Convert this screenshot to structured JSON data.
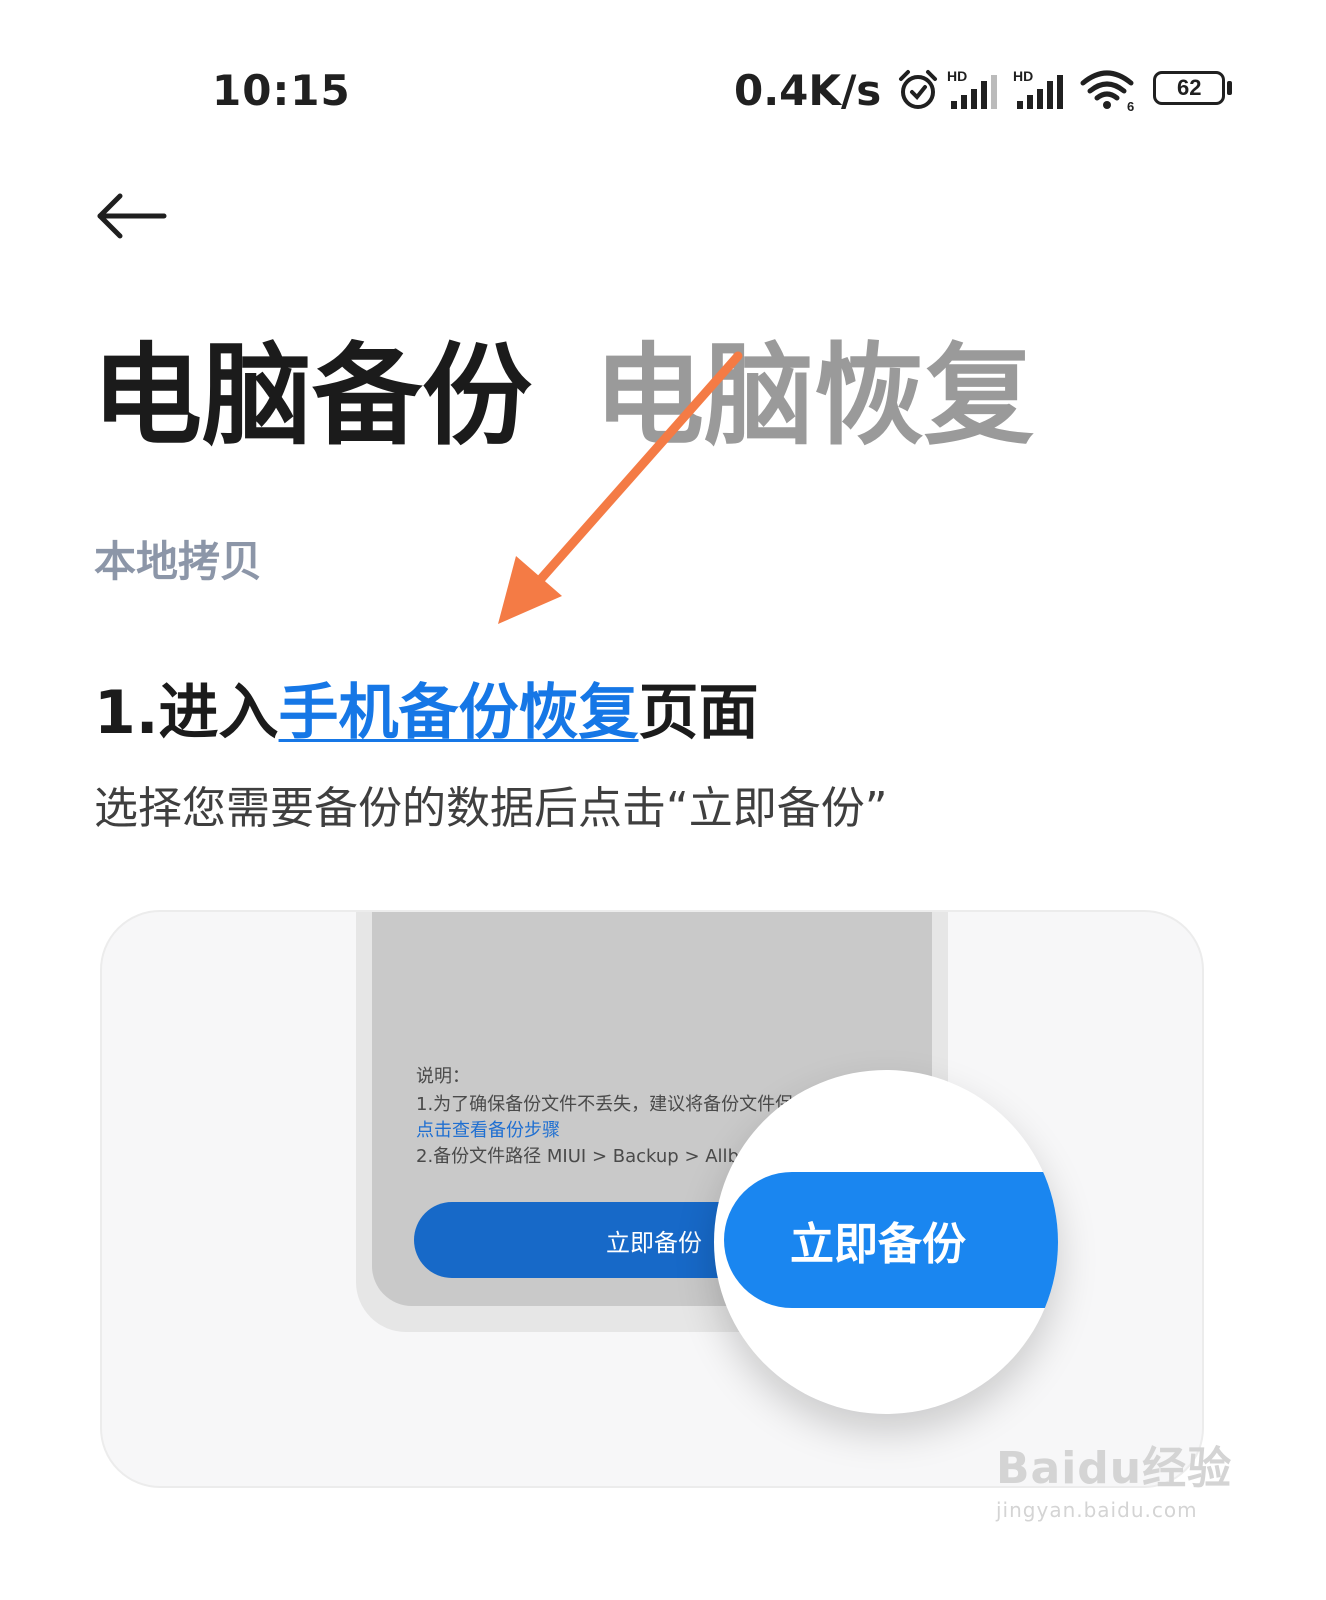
{
  "status_bar": {
    "time": "10:15",
    "net_speed": "0.4K/s",
    "battery": "62",
    "icons": [
      "alarm-icon",
      "hd-signal-icon",
      "hd-signal-icon",
      "wifi-icon",
      "battery-icon"
    ],
    "signal_badge": "HD",
    "wifi_badge": "6"
  },
  "header": {
    "back_icon": "back-arrow-icon",
    "tabs": [
      {
        "label": "电脑备份",
        "active": true
      },
      {
        "label": "电脑恢复",
        "active": false
      }
    ]
  },
  "section": {
    "label": "本地拷贝"
  },
  "step": {
    "prefix": "1.进入",
    "link": "手机备份恢复",
    "suffix": "页面",
    "description": "选择您需要备份的数据后点击“立即备份”"
  },
  "illustration": {
    "note_title": "说明：",
    "note_line1": "1.为了确保备份文件不丢失，建议将备份文件保存",
    "note_link": "点击查看备份步骤",
    "note_line2": "2.备份文件路径 MIUI > Backup > Allbac",
    "small_button": "立即备份",
    "big_button": "立即备份"
  },
  "watermark": {
    "logo": "Baidu经验",
    "url": "jingyan.baidu.com"
  },
  "colors": {
    "accent": "#1677e6",
    "annotation_arrow": "#f47b45",
    "inactive_tab": "#9a9a9a",
    "section_label": "#8c96a8"
  }
}
